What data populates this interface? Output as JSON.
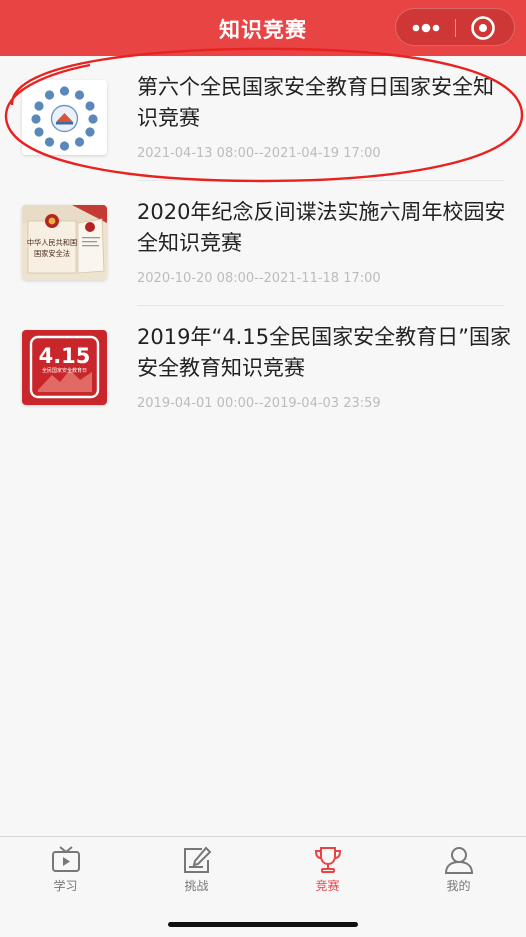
{
  "header": {
    "title": "知识竞赛"
  },
  "contests": [
    {
      "title": "第六个全民国家安全教育日国家安全知识竞赛",
      "date": "2021-04-13 08:00--2021-04-19 17:00",
      "thumb": "security-network-thumbnail"
    },
    {
      "title": "2020年纪念反间谍法实施六周年校园安全知识竞赛",
      "date": "2020-10-20 08:00--2021-11-18 17:00",
      "thumb": "national-security-law-book-thumbnail",
      "thumb_text": {
        "line1": "中华人民共和国",
        "line2": "国家安全法"
      }
    },
    {
      "title": "2019年“4.15全民国家安全教育日”国家安全教育知识竞赛",
      "date": "2019-04-01 00:00--2019-04-03 23:59",
      "thumb": "415-badge-thumbnail",
      "thumb_text": {
        "big": "4.15",
        "small": "全民国家安全教育日"
      }
    }
  ],
  "tabs": [
    {
      "label": "学习",
      "icon": "tv-icon",
      "active": false
    },
    {
      "label": "挑战",
      "icon": "edit-icon",
      "active": false
    },
    {
      "label": "竞赛",
      "icon": "trophy-icon",
      "active": true
    },
    {
      "label": "我的",
      "icon": "person-icon",
      "active": false
    }
  ],
  "colors": {
    "brand": "#e94444",
    "highlight": "#e8221f",
    "date": "#bcbcbc"
  }
}
